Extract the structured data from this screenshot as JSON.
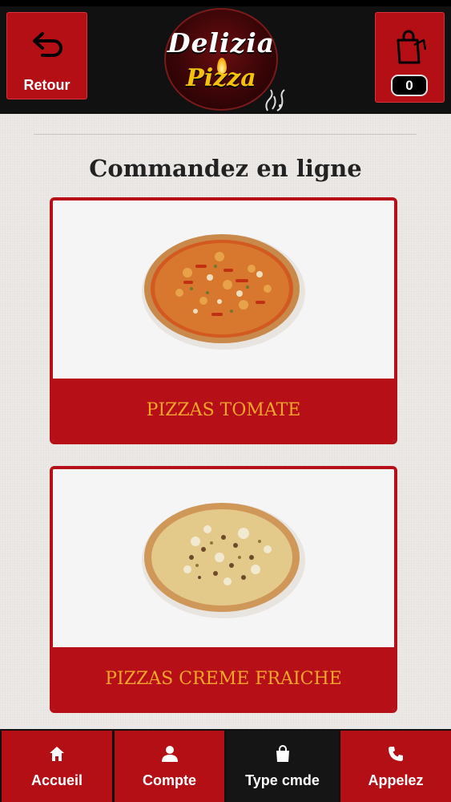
{
  "header": {
    "back_label": "Retour",
    "cart_count": "0",
    "logo": {
      "line1": "Delizia",
      "line2": "Pizza"
    }
  },
  "page_title": "Commandez en ligne",
  "categories": [
    {
      "label": "PIZZAS TOMATE",
      "image": "pizza-tomate-photo"
    },
    {
      "label": "PIZZAS CREME FRAICHE",
      "image": "pizza-creme-fraiche-photo"
    }
  ],
  "bottom_nav": [
    {
      "label": "Accueil",
      "icon": "home-icon"
    },
    {
      "label": "Compte",
      "icon": "user-icon"
    },
    {
      "label": "Type cmde",
      "icon": "bag-icon"
    },
    {
      "label": "Appelez",
      "icon": "phone-icon"
    }
  ],
  "colors": {
    "brand_red": "#b50f16",
    "label_gold": "#f3a62a",
    "header_black": "#111111",
    "background": "#ece9e6"
  }
}
